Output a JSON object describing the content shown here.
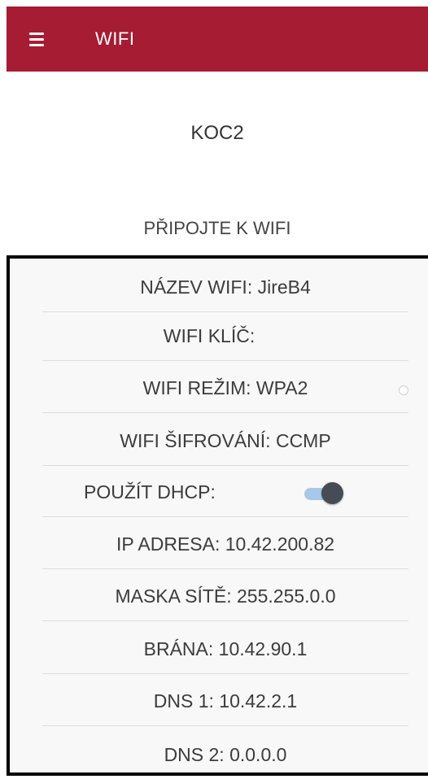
{
  "header": {
    "menu_icon": "hamburger-menu-icon",
    "title": "WIFI",
    "color": "#a51c33"
  },
  "device": {
    "name": "KOC2"
  },
  "connect": {
    "label": "PŘIPOJTE K WIFI"
  },
  "settings": {
    "wifi_name": "NÁZEV WIFI: JireB4",
    "wifi_key": "WIFI KLÍČ:",
    "wifi_mode": "WIFI REŽIM: WPA2",
    "wifi_encryption": "WIFI ŠIFROVÁNÍ: CCMP",
    "dhcp_label": "POUŽÍT DHCP:",
    "dhcp_enabled": true,
    "ip_address": "IP ADRESA: 10.42.200.82",
    "subnet_mask": "MASKA SÍTĚ: 255.255.0.0",
    "gateway": "BRÁNA: 10.42.90.1",
    "dns1": "DNS 1: 10.42.2.1",
    "dns2": "DNS 2: 0.0.0.0"
  }
}
